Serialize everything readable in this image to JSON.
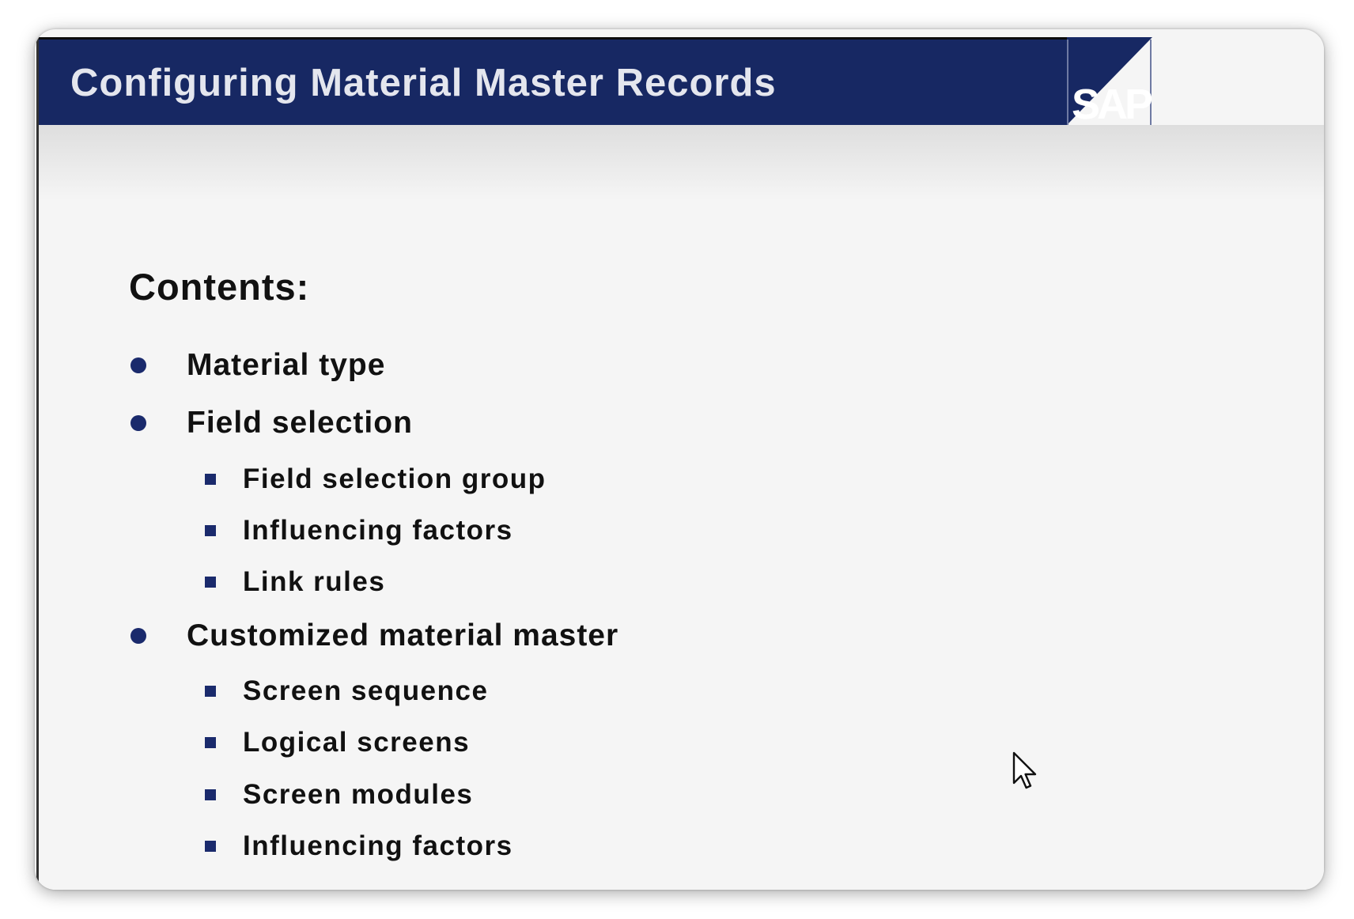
{
  "slide": {
    "title": "Configuring Material Master Records",
    "logo_text": "SAP",
    "contents_heading": "Contents:",
    "items": [
      {
        "label": "Material type",
        "subitems": []
      },
      {
        "label": "Field selection",
        "subitems": [
          "Field selection group",
          "Influencing factors",
          "Link rules"
        ]
      },
      {
        "label": "Customized material master",
        "subitems": [
          "Screen sequence",
          "Logical screens",
          "Screen modules",
          "Influencing factors"
        ]
      }
    ]
  },
  "colors": {
    "header_blue": "#172863",
    "bullet_blue": "#1a2a6c",
    "background": "#f5f5f5"
  },
  "icons": {
    "cursor": "mouse-pointer-icon"
  }
}
